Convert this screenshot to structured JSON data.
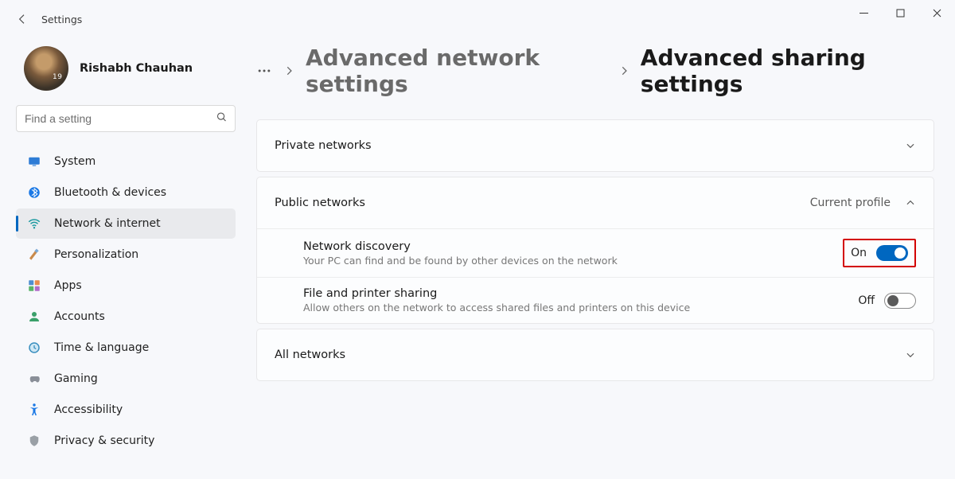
{
  "window": {
    "title": "Settings"
  },
  "user": {
    "name": "Rishabh Chauhan"
  },
  "search": {
    "placeholder": "Find a setting"
  },
  "sidebar": {
    "items": [
      {
        "id": "system",
        "label": "System"
      },
      {
        "id": "bluetooth",
        "label": "Bluetooth & devices"
      },
      {
        "id": "network",
        "label": "Network & internet"
      },
      {
        "id": "personalization",
        "label": "Personalization"
      },
      {
        "id": "apps",
        "label": "Apps"
      },
      {
        "id": "accounts",
        "label": "Accounts"
      },
      {
        "id": "time",
        "label": "Time & language"
      },
      {
        "id": "gaming",
        "label": "Gaming"
      },
      {
        "id": "accessibility",
        "label": "Accessibility"
      },
      {
        "id": "privacy",
        "label": "Privacy & security"
      }
    ],
    "active_index": 2
  },
  "breadcrumb": {
    "level1": "Advanced network settings",
    "level2": "Advanced sharing settings"
  },
  "sections": {
    "private": {
      "title": "Private networks"
    },
    "public": {
      "title": "Public networks",
      "badge": "Current profile",
      "expanded": true,
      "network_discovery": {
        "title": "Network discovery",
        "desc": "Your PC can find and be found by other devices on the network",
        "state": "On",
        "on": true,
        "highlighted": true
      },
      "file_printer_sharing": {
        "title": "File and printer sharing",
        "desc": "Allow others on the network to access shared files and printers on this device",
        "state": "Off",
        "on": false
      }
    },
    "all": {
      "title": "All networks"
    }
  }
}
